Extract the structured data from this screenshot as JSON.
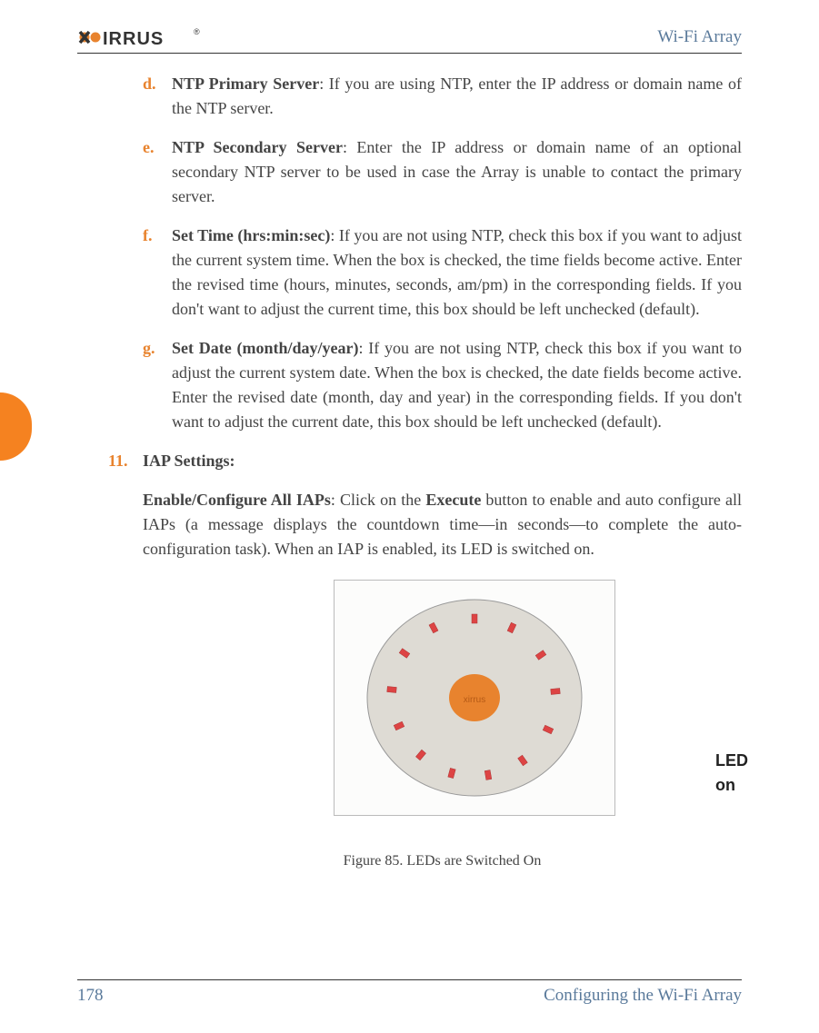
{
  "header": {
    "logo_text": "XIRRUS",
    "doc_title": "Wi-Fi Array"
  },
  "content": {
    "items": [
      {
        "marker": "d.",
        "bold": "NTP Primary Server",
        "text": ": If you are using NTP, enter the IP address or domain name of the NTP server."
      },
      {
        "marker": "e.",
        "bold": "NTP Secondary Server",
        "text": ": Enter the IP address or domain name of an optional secondary NTP server to be used in case the Array is unable to contact the primary server."
      },
      {
        "marker": "f.",
        "bold": "Set Time (hrs:min:sec)",
        "text": ": If you are not using NTP, check this box if you want to adjust the current system time. When the box is checked, the time fields become active. Enter the revised time (hours, minutes, seconds, am/pm) in the corresponding fields. If you don't want to adjust the current time, this box should be left unchecked (default)."
      },
      {
        "marker": "g.",
        "bold": "Set Date (month/day/year)",
        "text": ": If you are not using NTP, check this box if you want to adjust the current system date. When the box is checked, the date fields become active. Enter the revised date (month, day and year) in the corresponding fields. If you don't want to adjust the current date, this box should be left unchecked (default)."
      }
    ],
    "step11": {
      "marker": "11.",
      "title": "IAP Settings:",
      "para_bold": "Enable/Configure All IAPs",
      "para_1": ": Click on the ",
      "para_exec": "Execute",
      "para_2": " button to enable and auto configure all IAPs (a message displays the countdown time—in seconds—to complete the auto-configuration task). When an IAP is enabled, its LED is switched on."
    }
  },
  "figure": {
    "led_label": "LED on",
    "caption": "Figure 85. LEDs are Switched On"
  },
  "footer": {
    "page": "178",
    "chapter": "Configuring the Wi-Fi Array"
  }
}
